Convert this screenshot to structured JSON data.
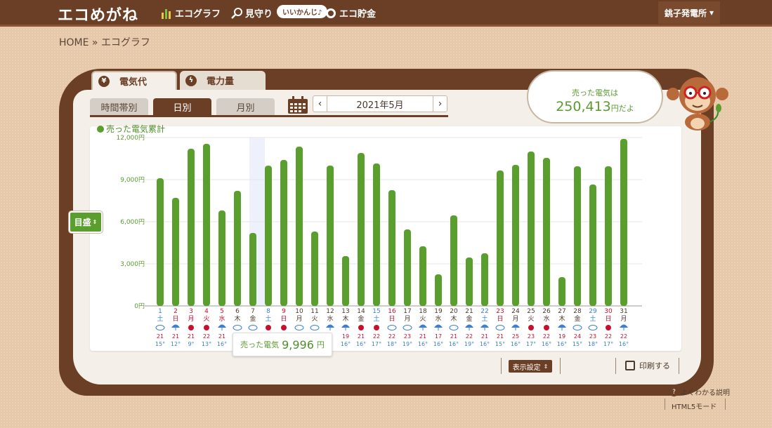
{
  "header": {
    "logo": "エコめがね",
    "nav": [
      {
        "label": "エコグラフ",
        "icon": "bar-chart-icon"
      },
      {
        "label": "見守り",
        "icon": "magnifier-icon"
      },
      {
        "label": "エコ貯金",
        "icon": "coin-icon"
      }
    ],
    "badge": "いいかんじ♪",
    "station": "銚子発電所"
  },
  "breadcrumb": "HOME » エコグラフ",
  "main_tabs": [
    {
      "label": "電気代",
      "icon": "yen-icon",
      "active": true
    },
    {
      "label": "電力量",
      "icon": "lightning-icon",
      "active": false
    }
  ],
  "sub_tabs": [
    {
      "label": "時間帯別",
      "active": false
    },
    {
      "label": "日別",
      "active": true
    },
    {
      "label": "月別",
      "active": false
    }
  ],
  "month": "2021年5月",
  "bubble": {
    "line1": "売った電気は",
    "amount": "250,413",
    "suffix": "円だよ"
  },
  "memori_label": "目盛",
  "tooltip": {
    "label": "売った電気",
    "value": "9,996",
    "unit": "円"
  },
  "display_settings": "表示設定",
  "print": "印刷する",
  "help": "よくわかる説明",
  "html5": "HTML5モード",
  "colors": {
    "bar": "#5a9f2e",
    "brown": "#6b3f26",
    "weekend_blue": "#3a7fd5",
    "holiday_red": "#c8102e"
  },
  "chart_data": {
    "type": "bar",
    "title": "売った電気累計",
    "ylim": [
      0,
      12000
    ],
    "y_ticks": [
      "0円",
      "3,000円",
      "6,000円",
      "9,000円",
      "12,000円"
    ],
    "highlight_day": 8,
    "days": [
      {
        "d": "1",
        "w": "土",
        "c": "blue",
        "wx": "cloud",
        "hi": "21",
        "lo": "15"
      },
      {
        "d": "2",
        "w": "日",
        "c": "red",
        "wx": "rain",
        "hi": "21",
        "lo": "12"
      },
      {
        "d": "3",
        "w": "月",
        "c": "red",
        "wx": "sun",
        "hi": "21",
        "lo": "9"
      },
      {
        "d": "4",
        "w": "火",
        "c": "red",
        "wx": "sun",
        "hi": "22",
        "lo": "13"
      },
      {
        "d": "5",
        "w": "水",
        "c": "red",
        "wx": "rain",
        "hi": "21",
        "lo": "16"
      },
      {
        "d": "6",
        "w": "木",
        "c": "dark",
        "wx": "cloud",
        "hi": "",
        "lo": ""
      },
      {
        "d": "7",
        "w": "金",
        "c": "dark",
        "wx": "cloud",
        "hi": "",
        "lo": ""
      },
      {
        "d": "8",
        "w": "土",
        "c": "blue",
        "wx": "sun",
        "hi": "",
        "lo": ""
      },
      {
        "d": "9",
        "w": "日",
        "c": "red",
        "wx": "sun",
        "hi": "",
        "lo": ""
      },
      {
        "d": "10",
        "w": "月",
        "c": "dark",
        "wx": "cloud",
        "hi": "",
        "lo": ""
      },
      {
        "d": "11",
        "w": "火",
        "c": "dark",
        "wx": "cloud",
        "hi": "",
        "lo": ""
      },
      {
        "d": "12",
        "w": "水",
        "c": "dark",
        "wx": "rain",
        "hi": "",
        "lo": ""
      },
      {
        "d": "13",
        "w": "木",
        "c": "dark",
        "wx": "rain",
        "hi": "19",
        "lo": "16"
      },
      {
        "d": "14",
        "w": "金",
        "c": "dark",
        "wx": "sun",
        "hi": "21",
        "lo": "16"
      },
      {
        "d": "15",
        "w": "土",
        "c": "blue",
        "wx": "sun",
        "hi": "22",
        "lo": "17"
      },
      {
        "d": "16",
        "w": "日",
        "c": "red",
        "wx": "cloud",
        "hi": "22",
        "lo": "18"
      },
      {
        "d": "17",
        "w": "月",
        "c": "dark",
        "wx": "cloud",
        "hi": "23",
        "lo": "19"
      },
      {
        "d": "18",
        "w": "火",
        "c": "dark",
        "wx": "rain",
        "hi": "21",
        "lo": "16"
      },
      {
        "d": "19",
        "w": "水",
        "c": "dark",
        "wx": "rain",
        "hi": "17",
        "lo": "16"
      },
      {
        "d": "20",
        "w": "木",
        "c": "dark",
        "wx": "cloud",
        "hi": "21",
        "lo": "16"
      },
      {
        "d": "21",
        "w": "金",
        "c": "dark",
        "wx": "rain",
        "hi": "22",
        "lo": "19"
      },
      {
        "d": "22",
        "w": "土",
        "c": "blue",
        "wx": "rain",
        "hi": "21",
        "lo": "16"
      },
      {
        "d": "23",
        "w": "日",
        "c": "red",
        "wx": "cloud",
        "hi": "21",
        "lo": "15"
      },
      {
        "d": "24",
        "w": "月",
        "c": "dark",
        "wx": "rain",
        "hi": "25",
        "lo": "16"
      },
      {
        "d": "25",
        "w": "火",
        "c": "dark",
        "wx": "sun",
        "hi": "23",
        "lo": "17"
      },
      {
        "d": "26",
        "w": "水",
        "c": "dark",
        "wx": "sun",
        "hi": "22",
        "lo": "16"
      },
      {
        "d": "27",
        "w": "木",
        "c": "dark",
        "wx": "rain",
        "hi": "19",
        "lo": "16"
      },
      {
        "d": "28",
        "w": "金",
        "c": "dark",
        "wx": "cloud",
        "hi": "24",
        "lo": "15"
      },
      {
        "d": "29",
        "w": "土",
        "c": "blue",
        "wx": "cloud",
        "hi": "23",
        "lo": "18"
      },
      {
        "d": "30",
        "w": "日",
        "c": "red",
        "wx": "sun",
        "hi": "22",
        "lo": "17"
      },
      {
        "d": "31",
        "w": "月",
        "c": "dark",
        "wx": "rain",
        "hi": "22",
        "lo": "16"
      }
    ],
    "values": [
      9100,
      7700,
      11200,
      11550,
      6800,
      8200,
      5200,
      9996,
      10400,
      11350,
      5300,
      10000,
      3550,
      10900,
      10150,
      8250,
      5450,
      4250,
      2250,
      6450,
      3450,
      3750,
      9650,
      10050,
      11000,
      10550,
      2050,
      9950,
      8650,
      9950,
      11900
    ]
  }
}
